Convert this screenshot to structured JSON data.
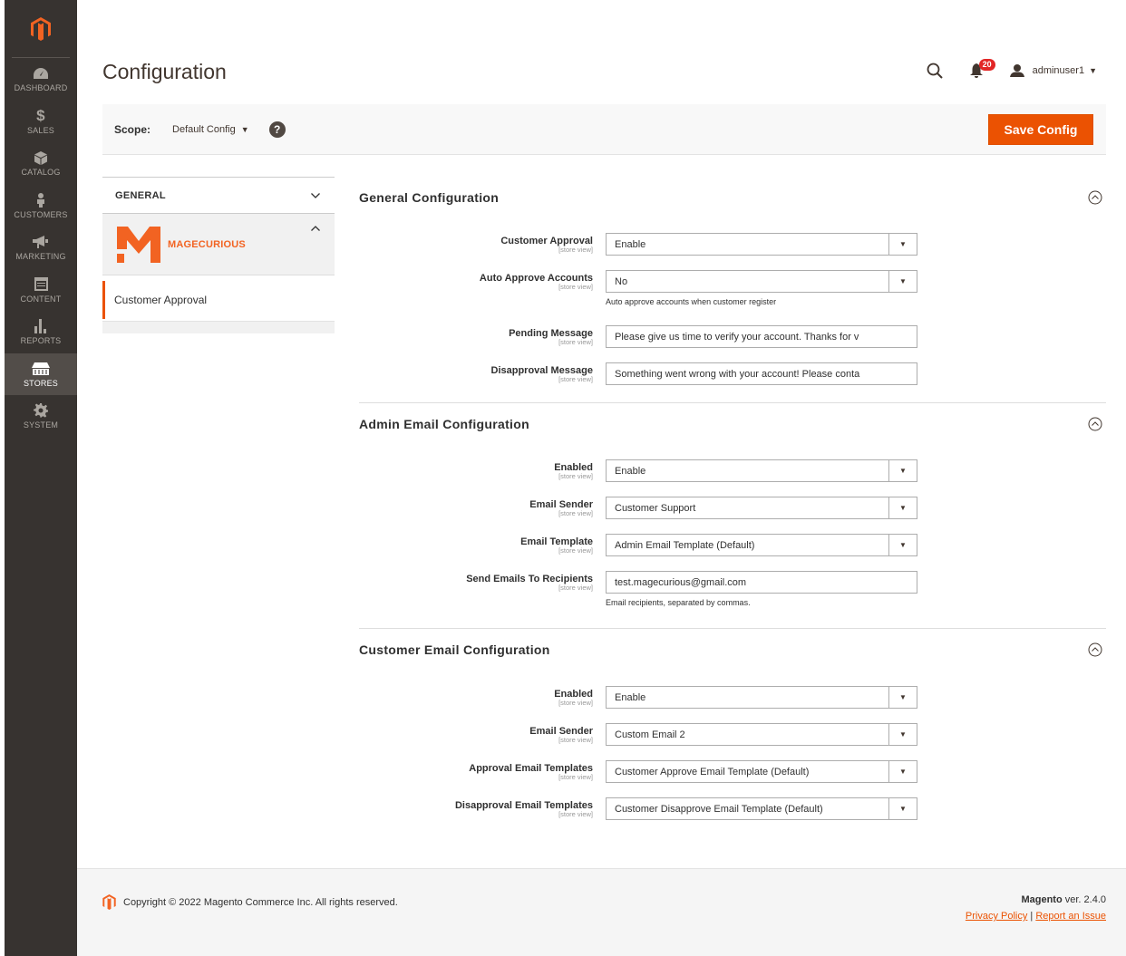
{
  "sidebar": {
    "items": [
      {
        "label": "DASHBOARD",
        "icon": "dashboard-icon"
      },
      {
        "label": "SALES",
        "icon": "dollar-icon"
      },
      {
        "label": "CATALOG",
        "icon": "cube-icon"
      },
      {
        "label": "CUSTOMERS",
        "icon": "person-icon"
      },
      {
        "label": "MARKETING",
        "icon": "megaphone-icon"
      },
      {
        "label": "CONTENT",
        "icon": "content-icon"
      },
      {
        "label": "REPORTS",
        "icon": "bar-chart-icon"
      },
      {
        "label": "STORES",
        "icon": "store-icon"
      },
      {
        "label": "SYSTEM",
        "icon": "gear-icon"
      }
    ],
    "active": "STORES"
  },
  "header": {
    "title": "Configuration",
    "notifications_count": "20",
    "username": "adminuser1"
  },
  "scope": {
    "label": "Scope:",
    "value": "Default Config",
    "help": "?",
    "save_label": "Save Config"
  },
  "tabs": {
    "general": "GENERAL",
    "vendor": "MAGECURIOUS",
    "item": "Customer Approval"
  },
  "sections": {
    "general": {
      "title": "General Configuration",
      "customer_approval": {
        "label": "Customer Approval",
        "scope": "[store view]",
        "value": "Enable"
      },
      "auto_approve": {
        "label": "Auto Approve Accounts",
        "scope": "[store view]",
        "value": "No",
        "note": "Auto approve accounts when customer register"
      },
      "pending_message": {
        "label": "Pending Message",
        "scope": "[store view]",
        "value": "Please give us time to verify your account. Thanks for v"
      },
      "disapproval_message": {
        "label": "Disapproval Message",
        "scope": "[store view]",
        "value": "Something went wrong with your account! Please conta"
      }
    },
    "admin_email": {
      "title": "Admin Email Configuration",
      "enabled": {
        "label": "Enabled",
        "scope": "[store view]",
        "value": "Enable"
      },
      "email_sender": {
        "label": "Email Sender",
        "scope": "[store view]",
        "value": "Customer Support"
      },
      "email_template": {
        "label": "Email Template",
        "scope": "[store view]",
        "value": "Admin Email Template (Default)"
      },
      "recipients": {
        "label": "Send Emails To Recipients",
        "scope": "[store view]",
        "value": "test.magecurious@gmail.com",
        "note": "Email recipients, separated by commas."
      }
    },
    "customer_email": {
      "title": "Customer Email Configuration",
      "enabled": {
        "label": "Enabled",
        "scope": "[store view]",
        "value": "Enable"
      },
      "email_sender": {
        "label": "Email Sender",
        "scope": "[store view]",
        "value": "Custom Email 2"
      },
      "approval_templates": {
        "label": "Approval Email Templates",
        "scope": "[store view]",
        "value": "Customer Approve Email Template (Default)"
      },
      "disapproval_templates": {
        "label": "Disapproval Email Templates",
        "scope": "[store view]",
        "value": "Customer Disapprove Email Template (Default)"
      }
    }
  },
  "footer": {
    "copyright": "Copyright © 2022 Magento Commerce Inc. All rights reserved.",
    "brand": "Magento",
    "version": " ver. 2.4.0",
    "privacy": "Privacy Policy",
    "separator": " | ",
    "report": "Report an Issue"
  },
  "colors": {
    "accent": "#eb5202",
    "sidebar_bg": "#373330",
    "vendor_orange": "#f26322"
  }
}
